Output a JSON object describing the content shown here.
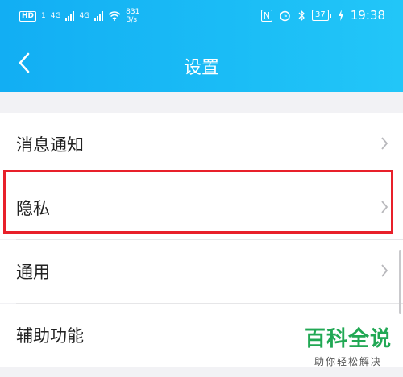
{
  "status_bar": {
    "hd_badge": "HD",
    "hd_badge_small": "1",
    "signal1_label": "4G",
    "signal2_label": "4G",
    "net_speed_value": "831",
    "net_speed_unit": "B/s",
    "nfc_icon": "N",
    "battery": "37",
    "time": "19:38"
  },
  "nav": {
    "title": "设置",
    "back_icon": "chevron-left-icon"
  },
  "settings_items": [
    {
      "label": "消息通知",
      "icon": "chevron-right-icon"
    },
    {
      "label": "隐私",
      "icon": "chevron-right-icon",
      "highlighted": true
    },
    {
      "label": "通用",
      "icon": "chevron-right-icon"
    },
    {
      "label": "辅助功能",
      "icon": "chevron-right-icon"
    }
  ],
  "watermark": {
    "title": "百科全说",
    "subtitle": "助你轻松解决"
  },
  "colors": {
    "header_gradient_start": "#12aef3",
    "header_gradient_end": "#22c6f8",
    "highlight_border": "#e8202a",
    "watermark_green": "#21a854"
  }
}
